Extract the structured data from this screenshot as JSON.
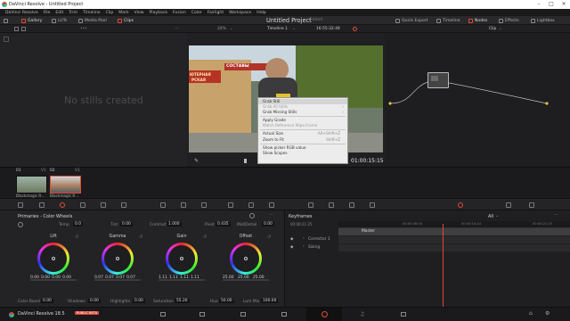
{
  "window": {
    "title": "DaVinci Resolve - Untitled Project"
  },
  "menu": [
    "DaVinci Resolve",
    "File",
    "Edit",
    "Trim",
    "Timeline",
    "Clip",
    "Mark",
    "View",
    "Playback",
    "Fusion",
    "Color",
    "Fairlight",
    "Workspace",
    "Help"
  ],
  "toolbar": {
    "left": [
      "Gallery",
      "LUTs",
      "Media Pool",
      "Clips"
    ],
    "project_title": "Untitled Project",
    "project_state": "Edited",
    "right": [
      "Quick Export",
      "Timeline",
      "Nodes",
      "Effects",
      "Lightbox"
    ]
  },
  "subbar": {
    "zoom": "24%",
    "timeline": "Timeline 1",
    "timecode": "16:55:32:44",
    "mode": "Clip"
  },
  "gallery": {
    "empty_text": "No stills created"
  },
  "viewer": {
    "sign_top": "СОСТАВЫ",
    "sign_left_1": "ЮТЕРНАЯ",
    "sign_left_2": "РСКАЯ",
    "timecode": "01:00:15:15"
  },
  "context_menu": [
    {
      "label": "Grab Still",
      "shortcut": "",
      "disabled": false,
      "highlighted": true,
      "sub": false
    },
    {
      "label": "Grab All Stills",
      "shortcut": "",
      "disabled": true,
      "highlighted": false,
      "sub": true
    },
    {
      "label": "Grab Missing Stills",
      "shortcut": "",
      "disabled": false,
      "highlighted": false,
      "sub": true
    },
    {
      "sep": true
    },
    {
      "label": "Apply Grade",
      "shortcut": "",
      "disabled": false,
      "highlighted": false,
      "sub": false
    },
    {
      "label": "Match Reference Wipe Frame",
      "shortcut": "",
      "disabled": true,
      "highlighted": false,
      "sub": false
    },
    {
      "sep": true
    },
    {
      "label": "Actual Size",
      "shortcut": "Alt+Shift+Z",
      "disabled": false,
      "highlighted": false,
      "sub": false
    },
    {
      "label": "Zoom to Fit",
      "shortcut": "Shift+Z",
      "disabled": false,
      "highlighted": false,
      "sub": false
    },
    {
      "sep": true
    },
    {
      "label": "Show picker RGB value",
      "shortcut": "",
      "disabled": false,
      "highlighted": false,
      "sub": false
    },
    {
      "label": "Show Scopes",
      "shortcut": "",
      "disabled": false,
      "highlighted": false,
      "sub": false
    }
  ],
  "clips": [
    {
      "num": "01",
      "track": "V1",
      "name": "Blackmagic R..."
    },
    {
      "num": "02",
      "track": "V1",
      "name": "Blackmagic R..."
    }
  ],
  "primaries": {
    "title": "Primaries - Color Wheels",
    "params": {
      "temp_label": "Temp",
      "temp": "0.0",
      "tint_label": "Tint",
      "tint": "0.00",
      "contrast_label": "Contrast",
      "contrast": "1.000",
      "pivot_label": "Pivot",
      "pivot": "0.435",
      "middetail_label": "Mid/Detail",
      "middetail": "0.00"
    },
    "wheels": [
      {
        "name": "Lift",
        "values": [
          "0.00",
          "0.00",
          "0.00",
          "0.00"
        ]
      },
      {
        "name": "Gamma",
        "values": [
          "0.07",
          "0.07",
          "0.07",
          "0.07"
        ]
      },
      {
        "name": "Gain",
        "values": [
          "1.11",
          "1.11",
          "1.11",
          "1.11"
        ]
      },
      {
        "name": "Offset",
        "values": [
          "25.00",
          "25.00",
          "25.00"
        ]
      }
    ],
    "bottom": {
      "colorboost_label": "Color Boost",
      "colorboost": "0.00",
      "shadows_label": "Shadows",
      "shadows": "0.00",
      "highlights_label": "Highlights",
      "highlights": "0.00",
      "saturation_label": "Saturation",
      "saturation": "55.20",
      "hue_label": "Hue",
      "hue": "50.00",
      "lummix_label": "Lum Mix",
      "lummix": "100.00"
    }
  },
  "keyframes": {
    "title": "Keyframes",
    "filter": "All",
    "ruler": [
      "00:00:21:25",
      "00:00:08:04",
      "00:00:14:24",
      "00:00:21:25"
    ],
    "master": "Master",
    "rows": [
      "Corrector 1",
      "Sizing"
    ]
  },
  "status": {
    "app": "DaVinci Resolve 18.5",
    "badge": "PUBLIC BETA"
  },
  "colors": {
    "accent": "#e04a3c",
    "badge": "#e04a3c"
  }
}
